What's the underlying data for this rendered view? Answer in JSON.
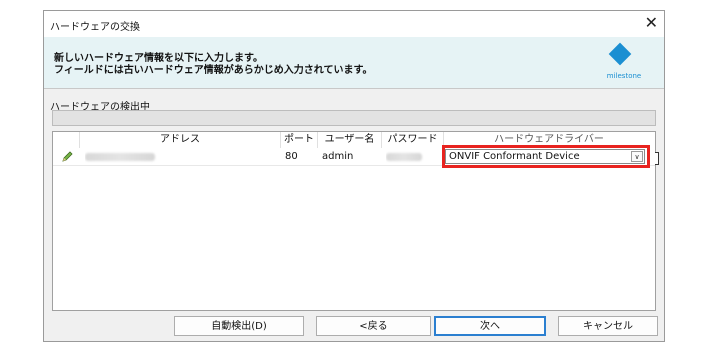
{
  "window": {
    "title": "ハードウェアの交換"
  },
  "header": {
    "line1": "新しいハードウェア情報を以下に入力します。",
    "line2": "フィールドには古いハードウェア情報があらかじめ入力されています。",
    "logo_text": "milestone",
    "accent": "#1b8fd2"
  },
  "detect": {
    "label": "ハードウェアの検出中",
    "progress": 0
  },
  "grid": {
    "columns": [
      "アドレス",
      "ポート",
      "ユーザー名",
      "パスワード",
      "ハードウェアドライバー"
    ],
    "rows": [
      {
        "port": "80",
        "user": "admin",
        "driver": "ONVIF Conformant Device"
      }
    ]
  },
  "buttons": {
    "auto_detect": "自動検出(D)",
    "back": "<戻る",
    "next": "次へ",
    "cancel": "キャンセル"
  },
  "colors": {
    "highlight": "#e8231f"
  }
}
